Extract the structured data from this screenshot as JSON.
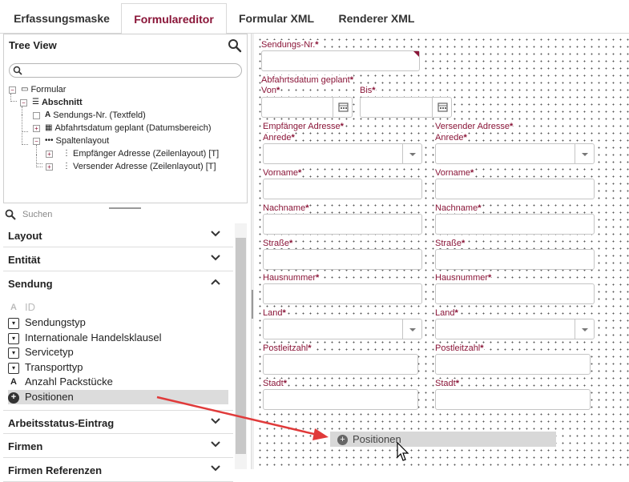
{
  "tabs": [
    {
      "label": "Erfassungsmaske"
    },
    {
      "label": "Formulareditor"
    },
    {
      "label": "Formular XML"
    },
    {
      "label": "Renderer XML"
    }
  ],
  "active_tab": "Formulareditor",
  "tree_view": {
    "title": "Tree View",
    "nodes": [
      {
        "label": "Formular"
      },
      {
        "label": "Abschnitt"
      },
      {
        "label": "Sendungs-Nr. (Textfeld)"
      },
      {
        "label": "Abfahrtsdatum geplant (Datumsbereich)"
      },
      {
        "label": "Spaltenlayout"
      },
      {
        "label": "Empfänger Adresse (Zeilenlayout) [T]"
      },
      {
        "label": "Versender Adresse (Zeilenlayout) [T]"
      }
    ]
  },
  "palette": {
    "search_placeholder": "Suchen",
    "sections": {
      "layout": "Layout",
      "entitaet": "Entität",
      "sendung": "Sendung",
      "arbeitsstatus": "Arbeitsstatus-Eintrag",
      "firmen": "Firmen",
      "firmen_referenzen": "Firmen Referenzen"
    },
    "sendung_items": {
      "id": "ID",
      "sendungstyp": "Sendungstyp",
      "handelsklausel": "Internationale Handelsklausel",
      "servicetyp": "Servicetyp",
      "transporttyp": "Transporttyp",
      "anzahl": "Anzahl Packstücke",
      "positionen": "Positionen"
    }
  },
  "form": {
    "sendungsnr": "Sendungs-Nr.",
    "abfahrt": "Abfahrtsdatum geplant",
    "von": "Von",
    "bis": "Bis",
    "empfaenger": "Empfänger Adresse",
    "versender": "Versender Adresse",
    "anrede": "Anrede",
    "vorname": "Vorname",
    "nachname": "Nachname",
    "strasse": "Straße",
    "hausnummer": "Hausnummer",
    "land": "Land",
    "plz": "Postleitzahl",
    "stadt": "Stadt",
    "required_mark": "*"
  },
  "drag_preview": {
    "label": "Positionen"
  },
  "colors": {
    "accent": "#8a1538",
    "arrow": "#e03a3a"
  }
}
